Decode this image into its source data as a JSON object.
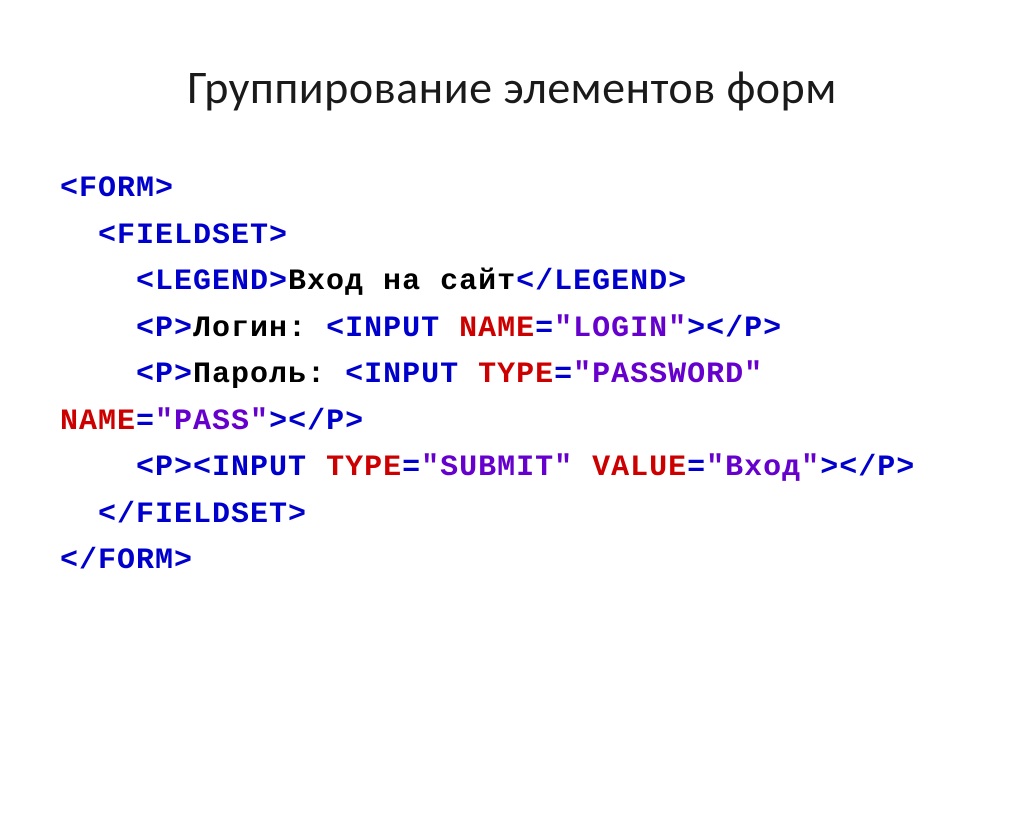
{
  "title": "Группирование элементов форм",
  "code": {
    "l1": {
      "open": "<FORM>"
    },
    "l2": {
      "open": "<FIELDSET>"
    },
    "l3": {
      "open1": "<LEGEND>",
      "text": "Вход на сайт",
      "close1": "</LEGEND>"
    },
    "l4": {
      "open1": "<P>",
      "text": "Логин: ",
      "open2": "<INPUT ",
      "attr1": "NAME",
      "eq1": "=",
      "val1": "\"LOGIN\"",
      "close2": ">",
      "close1": "</P>"
    },
    "l5": {
      "open1": "<P>",
      "text": "Пароль: ",
      "open2": "<INPUT ",
      "attr1": "TYPE",
      "eq1": "=",
      "val1": "\"PASSWORD\"",
      "sp": " ",
      "attr2": "NAME",
      "eq2": "=",
      "val2": "\"PASS\"",
      "close2": ">",
      "close1": "</P>"
    },
    "l6": {
      "open1": "<P>",
      "open2": "<INPUT ",
      "attr1": "TYPE",
      "eq1": "=",
      "val1": "\"SUBMIT\"",
      "sp": " ",
      "attr2": "VALUE",
      "eq2": "=",
      "val2": "\"Вход\"",
      "close2": ">",
      "close1": "</P>"
    },
    "l7": {
      "close": "</FIELDSET>"
    },
    "l8": {
      "close": "</FORM>"
    }
  }
}
